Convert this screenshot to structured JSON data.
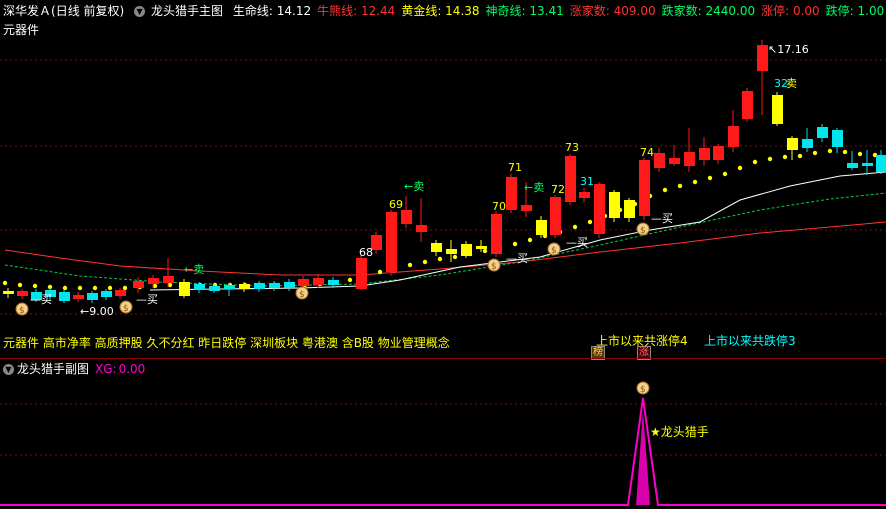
{
  "header": {
    "stock_name": "深华发Ａ",
    "mode": "(日线 前复权)",
    "indicator_name": "龙头猎手主图",
    "lines": [
      {
        "label": "生命线:",
        "value": "14.12",
        "color": "#ffffff"
      },
      {
        "label": "牛熊线:",
        "value": "12.44",
        "color": "#ff3333"
      },
      {
        "label": "黄金线:",
        "value": "14.38",
        "color": "#ffff00"
      },
      {
        "label": "神奇线:",
        "value": "13.41",
        "color": "#00ff66"
      },
      {
        "label": "涨家数:",
        "value": "409.00",
        "color": "#ff3333"
      },
      {
        "label": "跌家数:",
        "value": "2440.00",
        "color": "#00ff66"
      },
      {
        "label": "涨停:",
        "value": "0.00",
        "color": "#ff3333"
      },
      {
        "label": "跌停:",
        "value": "1.00",
        "color": "#00ff66"
      }
    ]
  },
  "main": {
    "label": "元器件",
    "concepts": "元器件 高市净率 高质押股 久不分红 昨日跌停 深圳板块 粤港澳 含B股 物业管理概念",
    "limit_up_text": "上市以来共涨停4",
    "limit_down_text": "上市以来共跌停3",
    "badge_bang": "榜",
    "badge_zhang": "涨",
    "price_high_label": "17.16",
    "price_low_label": "9.00",
    "buy_label": "买",
    "sell_label": "卖",
    "arrow_buy_label": "←买",
    "arrow_sell_label": "←卖",
    "numbers": [
      "68",
      "69",
      "70",
      "71",
      "72",
      "73",
      "31",
      "74",
      "32"
    ],
    "colors": {
      "up": "#ff1a1a",
      "down": "#00e5ee",
      "gold": "#ffff00",
      "life": "#ffffff",
      "bear": "#ff3333",
      "magic": "#00cc44"
    }
  },
  "sub": {
    "indicator_name": "龙头猎手副图",
    "xg_label": "XG:",
    "xg_value": "0.00",
    "signal_label": "★龙头猎手",
    "color": "#ff00cc"
  }
}
